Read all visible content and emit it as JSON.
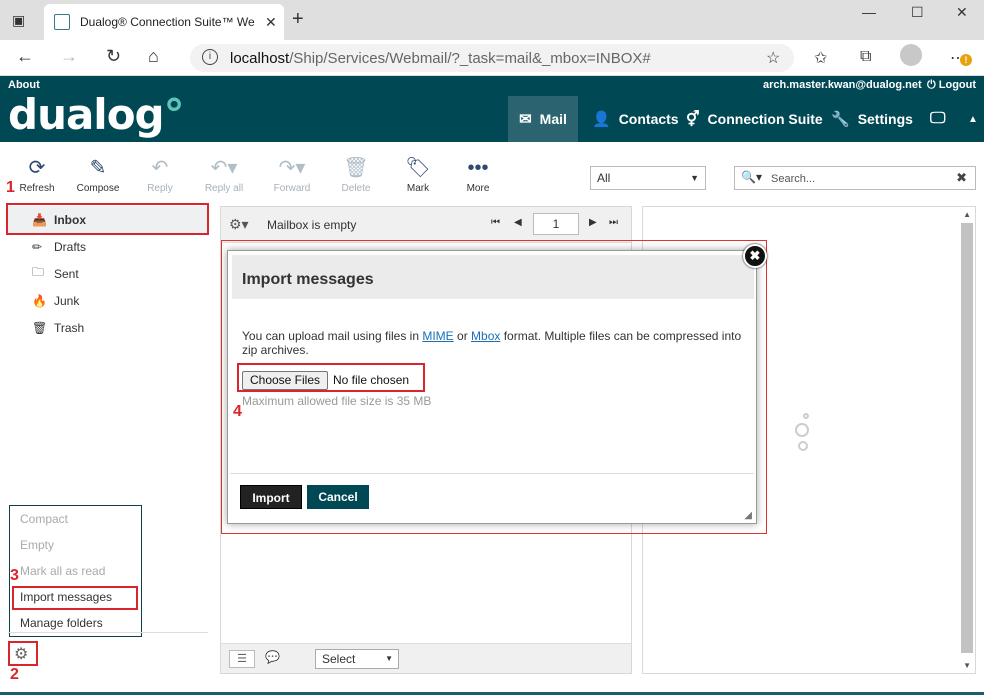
{
  "browser": {
    "tab_title": "Dualog® Connection Suite™ We",
    "tab_close": "✕",
    "new_tab": "+",
    "url_host": "localhost",
    "url_path": "/Ship/Services/Webmail/?_task=mail&_mbox=INBOX#",
    "icons": [
      "tab-actions-icon",
      "back-icon",
      "forward-icon",
      "reload-icon",
      "home-icon",
      "info-icon",
      "favorite-add-icon",
      "favorites-icon",
      "collections-icon",
      "profile-icon",
      "more-icon"
    ],
    "badge": "!"
  },
  "header": {
    "about": "About",
    "logo": "dualog",
    "user_email": "arch.master.kwan@dualog.net",
    "logout": "Logout",
    "nav": {
      "mail": "Mail",
      "contacts": "Contacts",
      "connection_suite": "Connection Suite",
      "settings": "Settings"
    }
  },
  "toolbar": {
    "refresh": "Refresh",
    "compose": "Compose",
    "reply": "Reply",
    "reply_all": "Reply all",
    "forward": "Forward",
    "delete": "Delete",
    "mark": "Mark",
    "more": "More",
    "filter_value": "All",
    "search_placeholder": "Search..."
  },
  "folders": [
    {
      "label": "Inbox",
      "icon": "inbox-icon"
    },
    {
      "label": "Drafts",
      "icon": "pencil-icon"
    },
    {
      "label": "Sent",
      "icon": "folder-icon"
    },
    {
      "label": "Junk",
      "icon": "fire-icon"
    },
    {
      "label": "Trash",
      "icon": "trash-icon"
    }
  ],
  "settings_menu": {
    "compact": "Compact",
    "empty": "Empty",
    "mark_all_read": "Mark all as read",
    "import_messages": "Import messages",
    "manage_folders": "Manage folders"
  },
  "message_list": {
    "status": "Mailbox is empty",
    "page": "1",
    "select_label": "Select"
  },
  "import_dialog": {
    "title": "Import messages",
    "text_before": "You can upload mail using files in ",
    "mime_link": "MIME",
    "text_or": " or ",
    "mbox_link": "Mbox",
    "text_after": " format. Multiple files can be compressed into zip archives.",
    "choose_files": "Choose Files",
    "no_file": "No file chosen",
    "max_size": "Maximum allowed file size is 35 MB",
    "import_button": "Import",
    "cancel_button": "Cancel",
    "close": "✖"
  },
  "annotations": {
    "m1": "1",
    "m2": "2",
    "m3": "3",
    "m4": "4"
  },
  "colors": {
    "header_bg": "#004854",
    "accent": "#5fc4b8",
    "annotation_red": "#d9262c"
  }
}
